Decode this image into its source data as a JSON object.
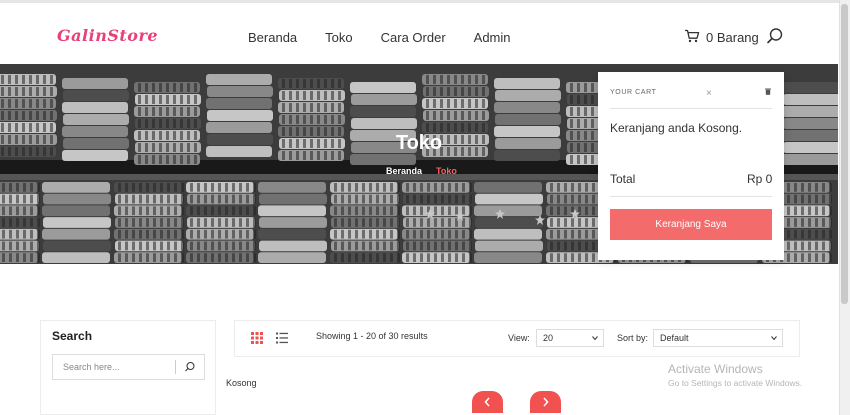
{
  "header": {
    "logo_text": "GalinStore",
    "nav": [
      "Beranda",
      "Toko",
      "Cara Order",
      "Admin"
    ],
    "cart_label": "0 Barang"
  },
  "hero": {
    "title": "Toko",
    "breadcrumb": {
      "home": "Beranda",
      "current": "Toko"
    }
  },
  "cart": {
    "title": "YOUR CART",
    "empty_message": "Keranjang anda Kosong.",
    "total_label": "Total",
    "total_value": "Rp 0",
    "button_label": "Keranjang Saya"
  },
  "sidebar": {
    "title": "Search",
    "search_placeholder": "Search here..."
  },
  "toolbar": {
    "showing_text": "Showing 1 - 20 of 30 results",
    "view_label": "View:",
    "view_value": "20",
    "sort_label": "Sort by:",
    "sort_value": "Default"
  },
  "content": {
    "empty_text": "Kosong"
  },
  "watermark": {
    "title": "Activate Windows",
    "subtitle": "Go to Settings to activate Windows."
  },
  "colors": {
    "brand": "#e8407a",
    "accent": "#f36b6b",
    "pager": "#f2524f"
  },
  "icons": {
    "cart": "cart-icon",
    "search": "search-icon",
    "close": "close-icon",
    "trash": "trash-icon",
    "grid": "grid-view-icon",
    "list": "list-view-icon",
    "prev": "chevron-left-icon",
    "next": "chevron-right-icon"
  }
}
